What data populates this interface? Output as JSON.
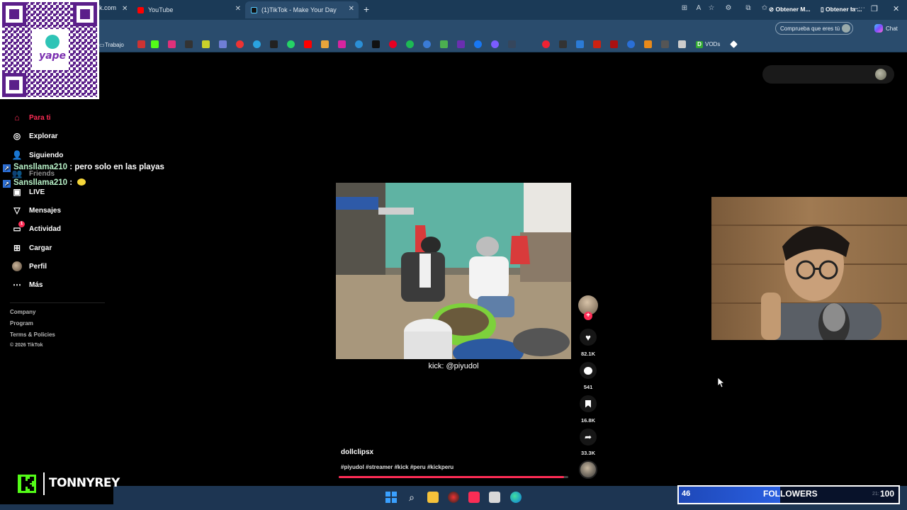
{
  "browser": {
    "tabs": [
      {
        "label": "YouTube",
        "active": false,
        "favicon_color": "#ff0000"
      },
      {
        "label": "(1)TikTok - Make Your Day",
        "active": true,
        "favicon_color": "#111111"
      }
    ],
    "new_tab_symbol": "+",
    "address": "k.com",
    "profile_button": "Comprueba que eres tú",
    "chat_label": "Chat",
    "bookmarks": {
      "folder_label": "Trabajo",
      "vods_label": "VODs"
    }
  },
  "qr": {
    "brand": "yape"
  },
  "sidebar": {
    "items": [
      {
        "label": "Para ti",
        "icon": "home-icon"
      },
      {
        "label": "Explorar",
        "icon": "compass-icon"
      },
      {
        "label": "Siguiendo",
        "icon": "following-icon"
      },
      {
        "label": "Friends",
        "icon": "friends-icon"
      },
      {
        "label": "LIVE",
        "icon": "live-icon"
      },
      {
        "label": "Mensajes",
        "icon": "send-icon"
      },
      {
        "label": "Actividad",
        "icon": "activity-icon",
        "badge": "1"
      },
      {
        "label": "Cargar",
        "icon": "upload-icon"
      },
      {
        "label": "Perfil",
        "icon": "avatar"
      },
      {
        "label": "Más",
        "icon": "more-icon"
      }
    ],
    "footer": [
      "Company",
      "Program",
      "Terms & Policies",
      "© 2026 TikTok"
    ]
  },
  "chat": [
    {
      "user": "Sansllama210",
      "message": "pero solo en las playas"
    },
    {
      "user": "Sansllama210",
      "message": ""
    }
  ],
  "topright": {
    "get_app": "Obtener M...",
    "get_desktop": "Obtener la ..."
  },
  "video": {
    "caption": "kick: @piyudol",
    "author": "dollclipsx",
    "hashtags": "#piyudol #streamer #kick #peru #kickperu",
    "progress": 0.98
  },
  "actions": {
    "likes": "82.1K",
    "comments": "541",
    "saves": "16.8K",
    "shares": "33.3K"
  },
  "overlay": {
    "kick_name": "TONNYREY",
    "followers_count": "46",
    "followers_label": "FOLLOWERS",
    "followers_goal": "100",
    "followers_progress": 0.46
  }
}
